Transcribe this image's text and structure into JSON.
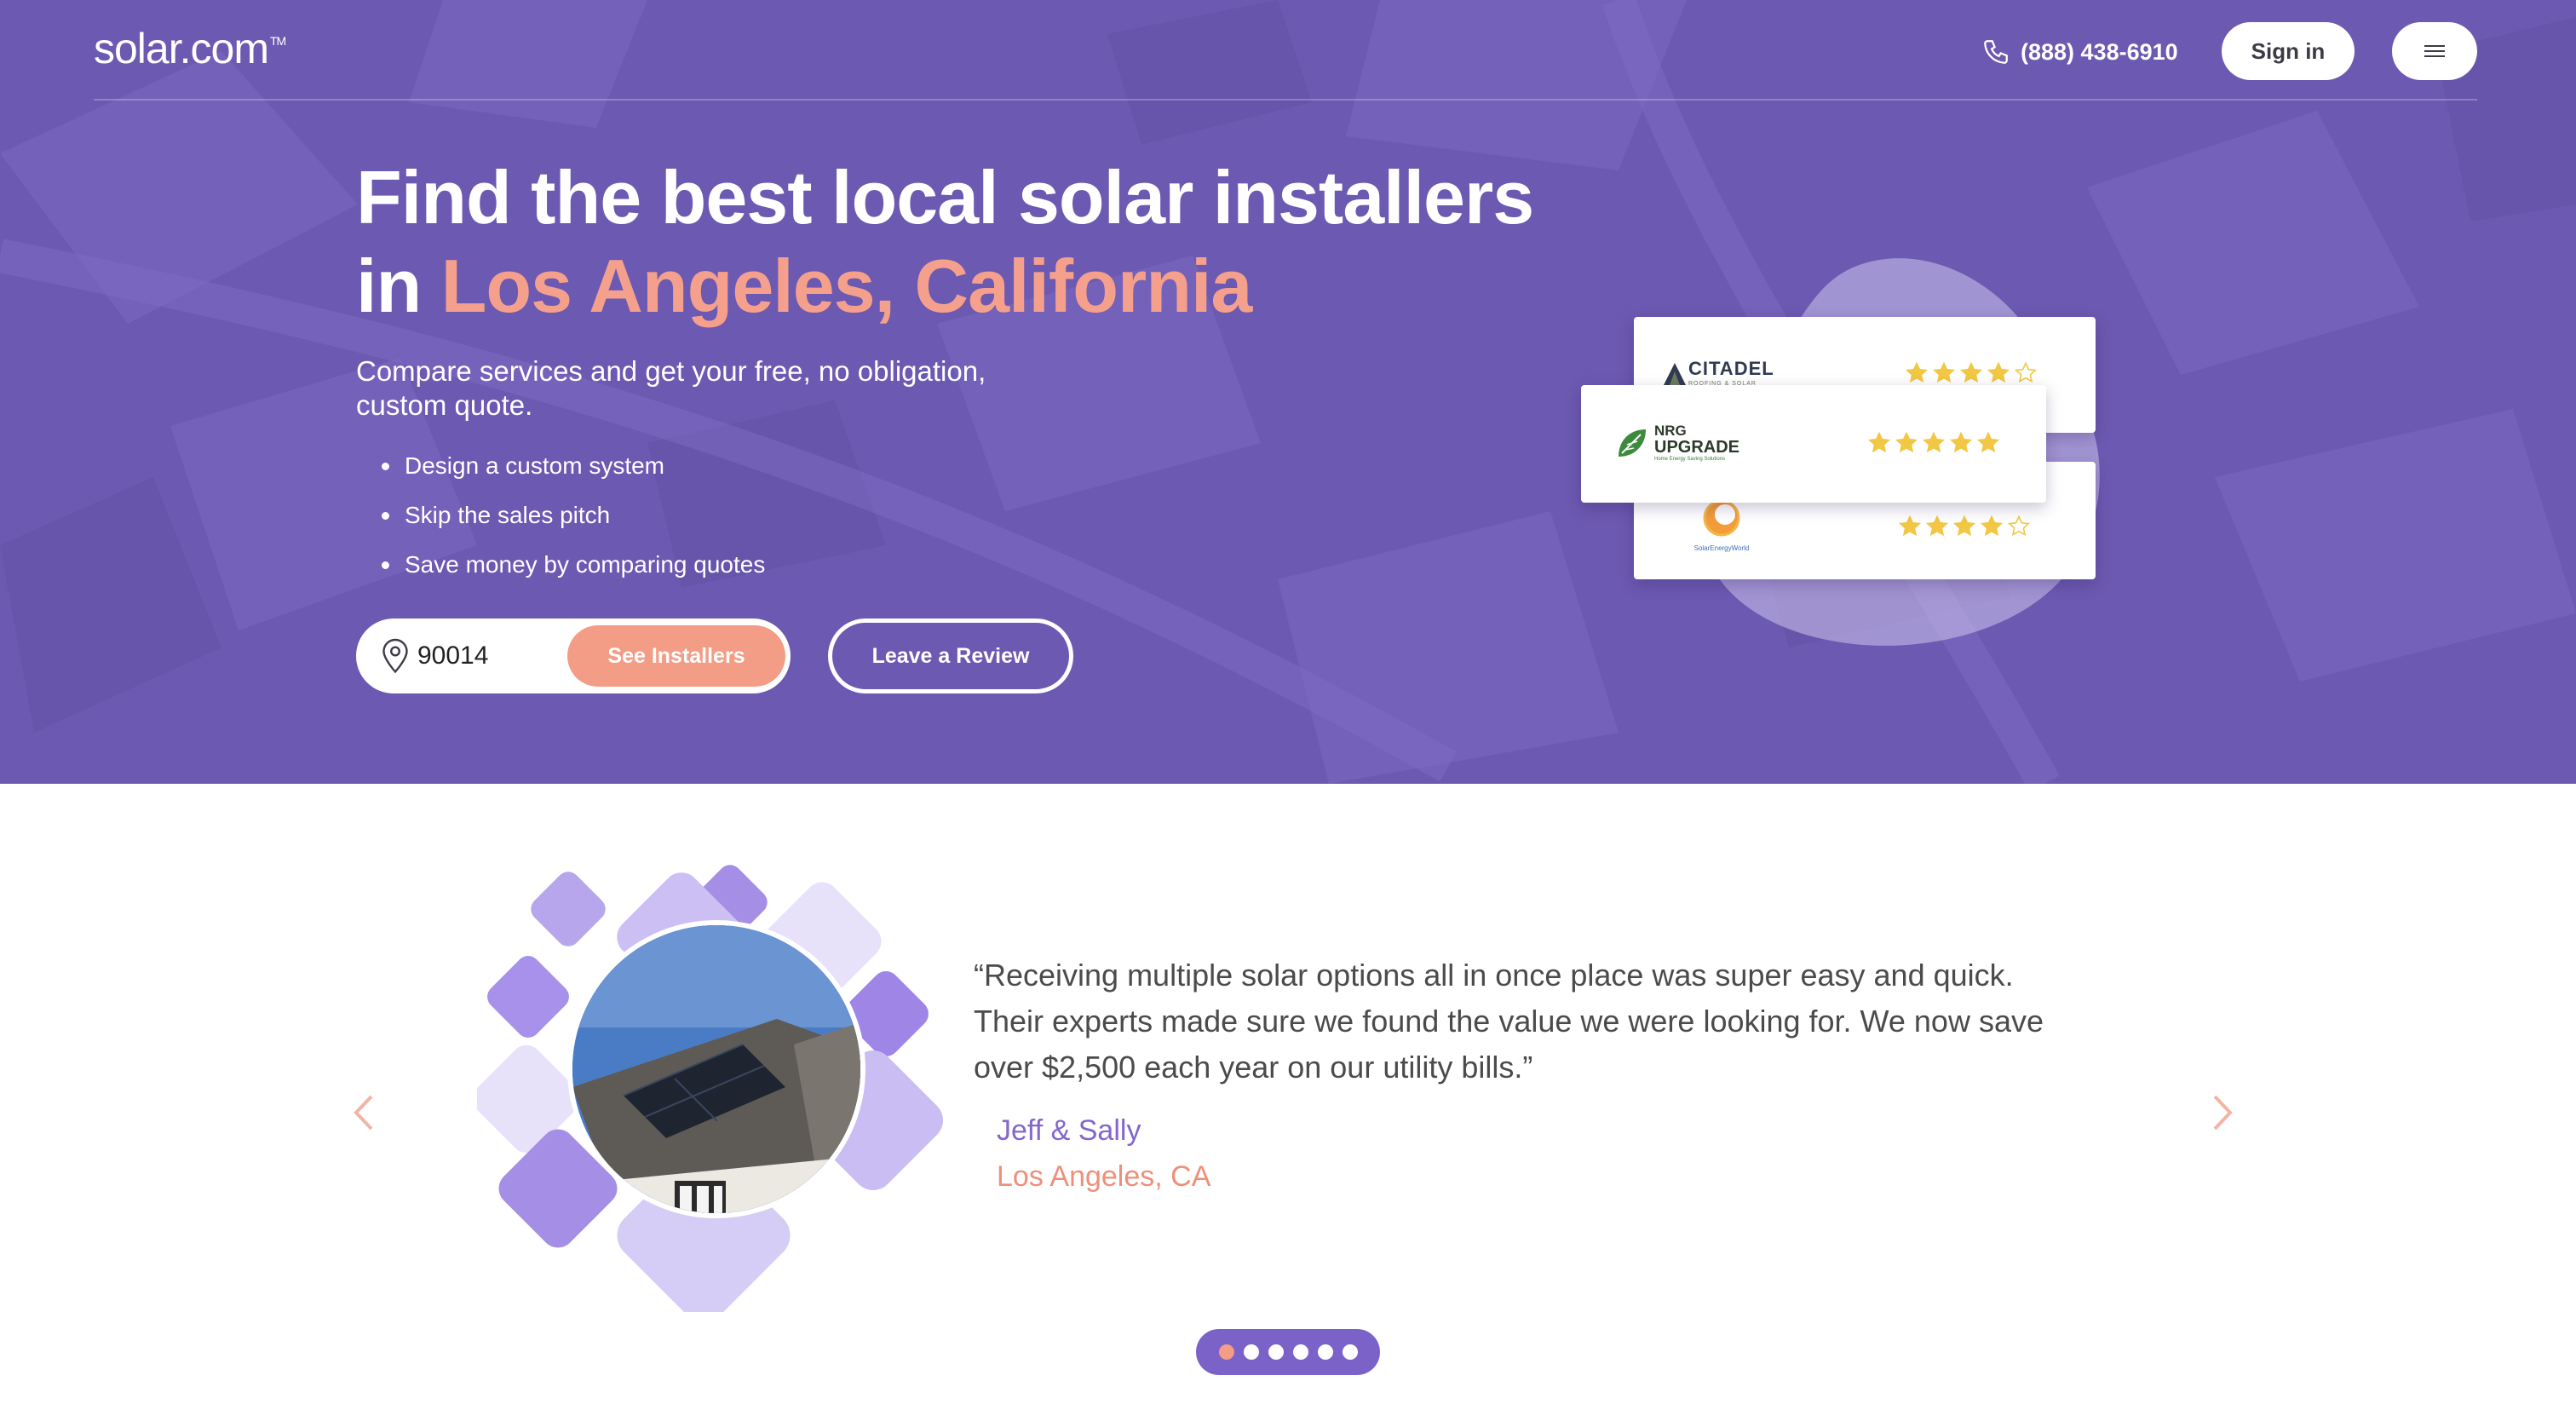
{
  "header": {
    "logo_text": "solar.com",
    "logo_tm": "TM",
    "phone": "(888) 438-6910",
    "signin_label": "Sign in"
  },
  "hero": {
    "title_line1": "Find the best local solar installers",
    "title_in": "in",
    "title_city": "Los Angeles, California",
    "subtitle": "Compare services and get your free, no obligation, custom quote.",
    "bullets": [
      "Design a custom system",
      "Skip the sales pitch",
      "Save money by comparing quotes"
    ],
    "zip_value": "90014",
    "see_installers_label": "See Installers",
    "leave_review_label": "Leave a Review"
  },
  "installers": [
    {
      "name": "CITADEL",
      "tagline": "ROOFING & SOLAR",
      "rating": 4
    },
    {
      "name_line1": "NRG",
      "name_line2": "UPGRADE",
      "tagline": "Home Energy Saving Solutions",
      "rating": 5
    },
    {
      "name": "SolarEnergyWorld",
      "rating": 4
    }
  ],
  "testimonial": {
    "quote": "“Receiving multiple solar options all in once place was super easy and quick. Their experts made sure we found the value we were looking for. We now save over $2,500 each year on our utility bills.”",
    "author": "Jeff & Sally",
    "location": "Los Angeles, CA",
    "slide_count": 6,
    "active_slide": 1
  },
  "colors": {
    "hero_purple": "#6f5cb0",
    "accent_coral": "#f39c86",
    "author_purple": "#8466cc",
    "star_gold": "#f2c744"
  },
  "icons": [
    "phone-icon",
    "menu-icon",
    "location-pin-icon",
    "chevron-left-icon",
    "chevron-right-icon",
    "star-icon"
  ]
}
